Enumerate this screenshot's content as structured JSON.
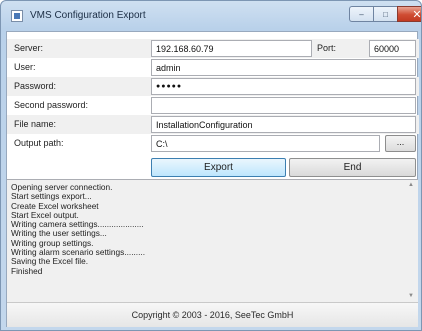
{
  "window": {
    "title": "VMS Configuration Export",
    "controls": {
      "minimize": "–",
      "maximize": "□",
      "close": "✕"
    }
  },
  "form": {
    "server": {
      "label": "Server:",
      "value": "192.168.60.79"
    },
    "port": {
      "label": "Port:",
      "value": "60000"
    },
    "user": {
      "label": "User:",
      "value": "admin"
    },
    "password": {
      "label": "Password:",
      "value": "●●●●●"
    },
    "second_password": {
      "label": "Second password:",
      "value": ""
    },
    "file_name": {
      "label": "File name:",
      "value": "InstallationConfiguration"
    },
    "output_path": {
      "label": "Output path:",
      "value": "C:\\"
    },
    "browse_label": "..."
  },
  "actions": {
    "export_label": "Export",
    "end_label": "End"
  },
  "log": {
    "lines": [
      "Opening server connection.",
      "Start settings export...",
      "Create Excel worksheet",
      "Start Excel output.",
      "Writing camera settings....................",
      "Writing the user settings...",
      "Writing group settings.",
      "Writing alarm scenario settings.........",
      "Saving the Excel file.",
      "Finished"
    ],
    "scroll_up": "▲",
    "scroll_down": "▼"
  },
  "footer": {
    "copyright": "Copyright © 2003 - 2016, SeeTec GmbH"
  }
}
